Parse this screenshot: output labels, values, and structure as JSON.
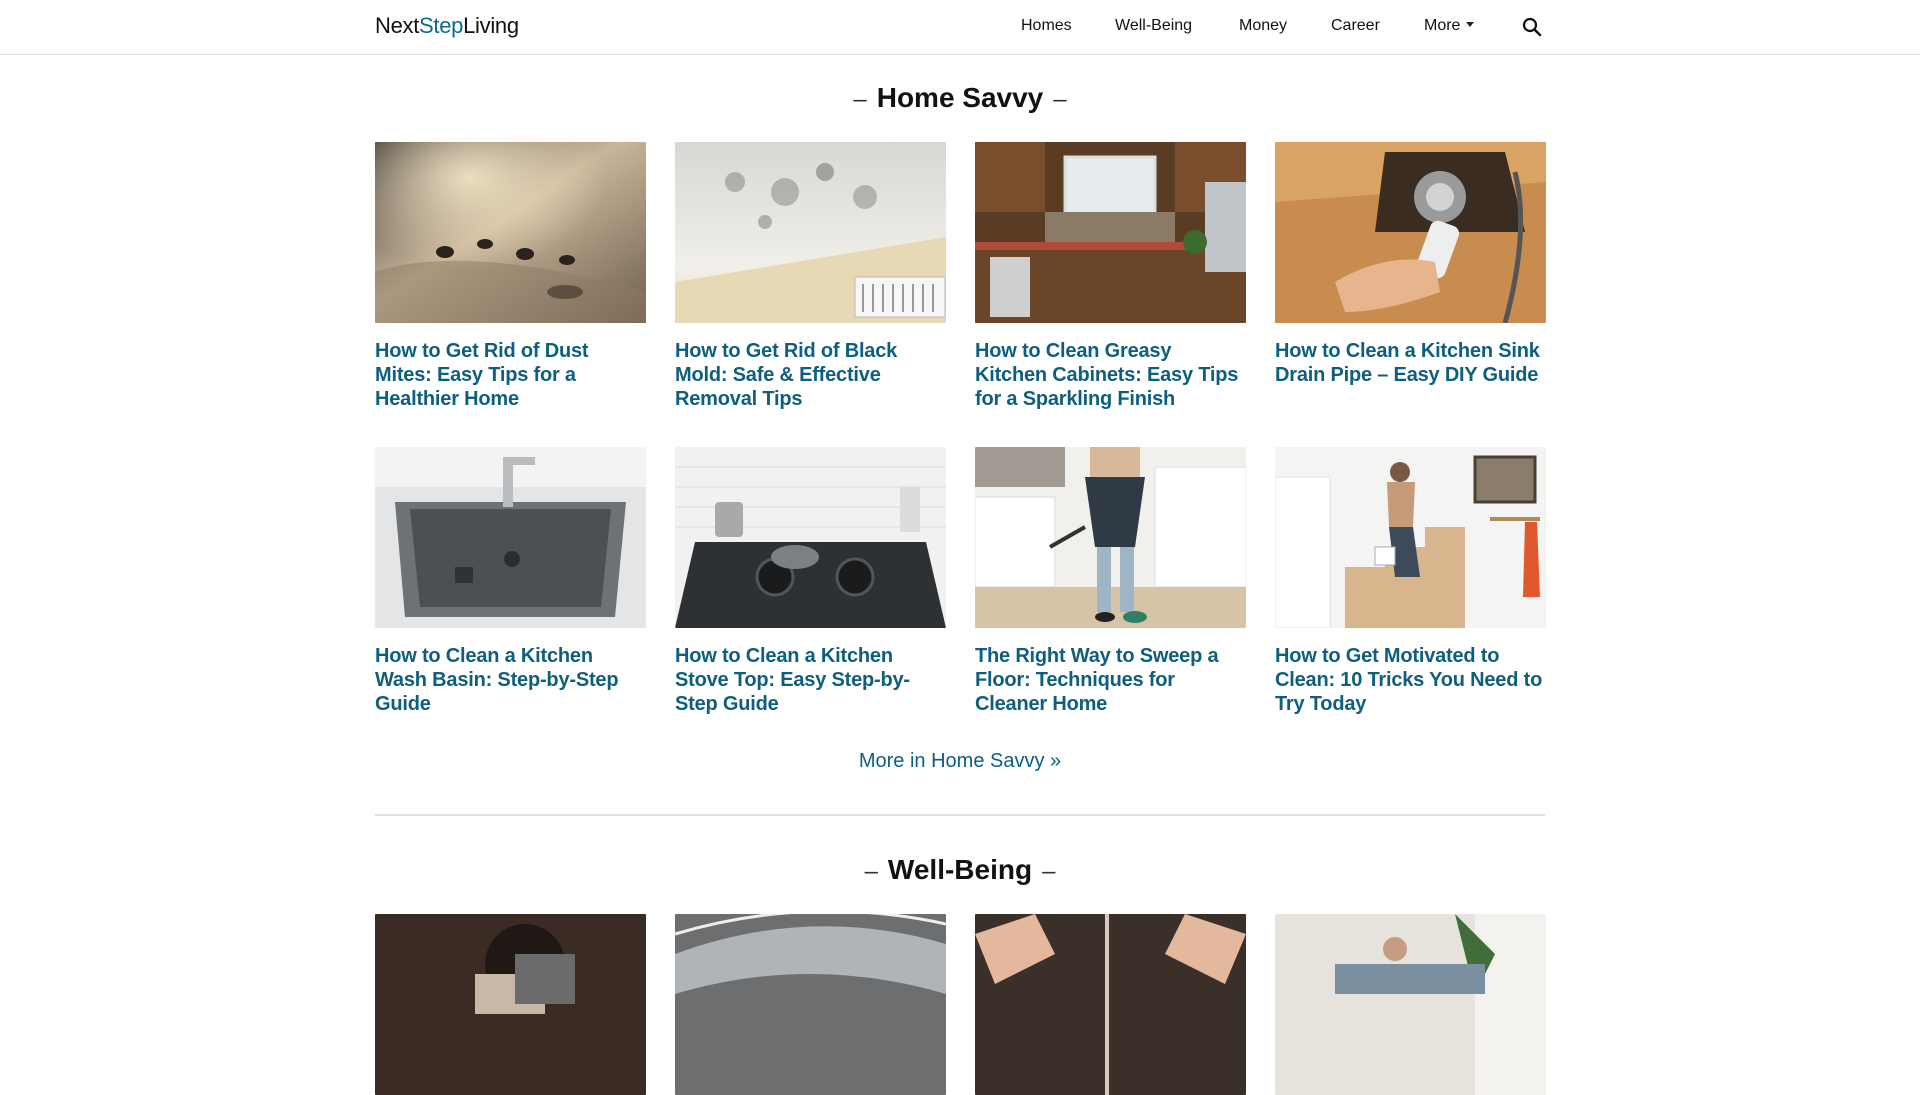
{
  "header": {
    "logo": {
      "part1": "Next",
      "part2": "Step",
      "part3": "Living"
    },
    "nav": [
      {
        "label": "Homes"
      },
      {
        "label": "Well-Being"
      },
      {
        "label": "Money"
      },
      {
        "label": "Career"
      },
      {
        "label": "More"
      }
    ],
    "search_icon": "search-icon"
  },
  "sections": [
    {
      "title": "Home Savvy",
      "cards": [
        {
          "title": "How to Get Rid of Dust Mites: Easy Tips for a Healthier Home"
        },
        {
          "title": "How to Get Rid of Black Mold: Safe & Effective Removal Tips"
        },
        {
          "title": "How to Clean Greasy Kitchen Cabinets: Easy Tips for a Sparkling Finish"
        },
        {
          "title": "How to Clean a Kitchen Sink Drain Pipe – Easy DIY Guide"
        },
        {
          "title": "How to Clean a Kitchen Wash Basin: Step-by-Step Guide"
        },
        {
          "title": "How to Clean a Kitchen Stove Top: Easy Step-by-Step Guide"
        },
        {
          "title": "The Right Way to Sweep a Floor: Techniques for Cleaner Home"
        },
        {
          "title": "How to Get Motivated to Clean: 10 Tricks You Need to Try Today"
        }
      ],
      "more_link": "More in Home Savvy »"
    },
    {
      "title": "Well-Being",
      "cards": []
    }
  ],
  "colors": {
    "accent": "#0e5f7e",
    "logo_accent": "#0e6a8a",
    "divider": "#e2e2e2"
  }
}
